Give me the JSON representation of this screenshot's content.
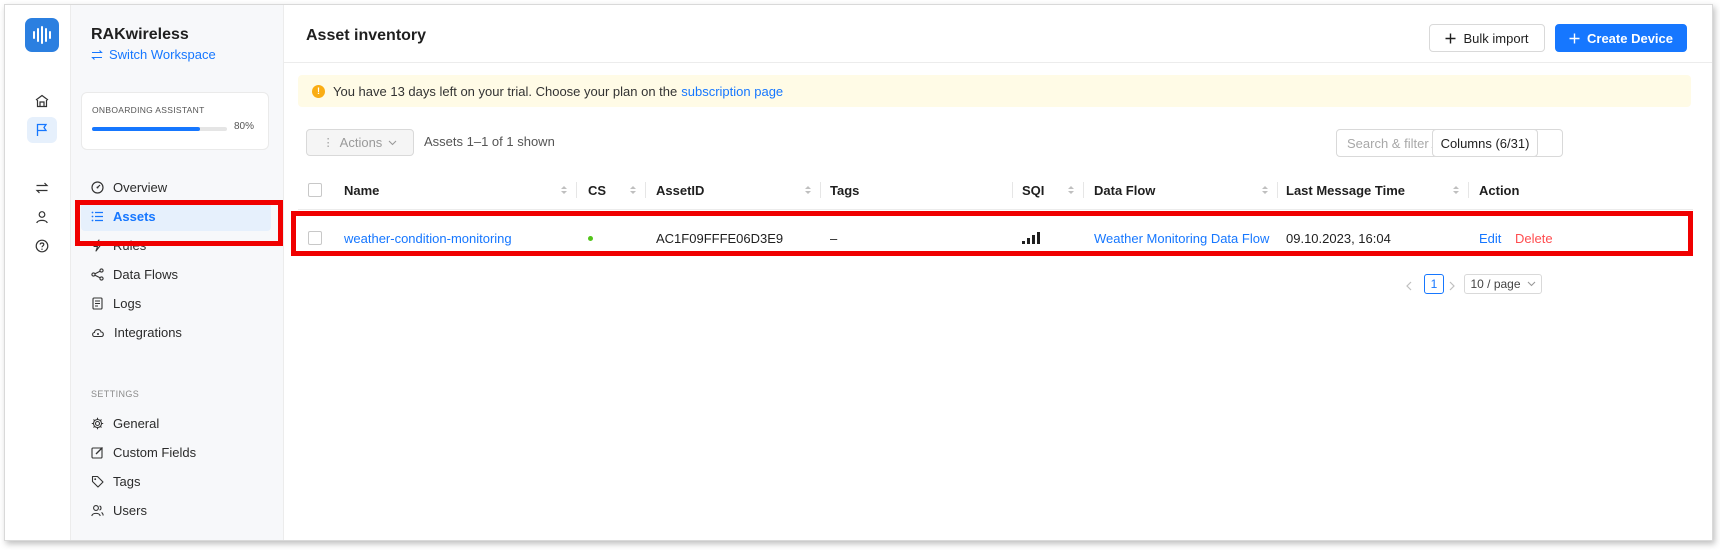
{
  "colors": {
    "accent": "#1677ff",
    "highlight": "#f00000",
    "trial_bg": "#fffbe6",
    "online": "#52c41a",
    "danger": "#ff4d4f"
  },
  "rail": {
    "icons": [
      "home-icon",
      "flag-icon",
      "swap-icon",
      "user-icon",
      "help-icon"
    ]
  },
  "sidebar": {
    "org_name": "RAKwireless",
    "switch_workspace": "Switch Workspace",
    "onboarding": {
      "title": "ONBOARDING ASSISTANT",
      "progress_percent": 80,
      "progress_label": "80%"
    },
    "nav": [
      {
        "label": "Overview",
        "icon": "dashboard-icon"
      },
      {
        "label": "Assets",
        "icon": "list-icon",
        "active": true
      },
      {
        "label": "Rules",
        "icon": "bolt-icon"
      },
      {
        "label": "Data Flows",
        "icon": "share-icon"
      },
      {
        "label": "Logs",
        "icon": "log-icon"
      },
      {
        "label": "Integrations",
        "icon": "cloud-icon"
      }
    ],
    "settings_label": "SETTINGS",
    "settings": [
      {
        "label": "General",
        "icon": "gear-icon"
      },
      {
        "label": "Custom Fields",
        "icon": "edit-icon"
      },
      {
        "label": "Tags",
        "icon": "tag-icon"
      },
      {
        "label": "Users",
        "icon": "users-icon"
      }
    ]
  },
  "header": {
    "title": "Asset inventory",
    "bulk_import": "Bulk import",
    "create_device": "Create Device"
  },
  "trial": {
    "text": "You have 13 days left on your trial. Choose your plan on the",
    "link": "subscription page"
  },
  "toolbar": {
    "actions": "Actions",
    "count": "Assets 1–1 of 1 shown",
    "search_placeholder": "Search & filter Asset list",
    "columns": "Columns (6/31)"
  },
  "table": {
    "headers": {
      "name": "Name",
      "cs": "CS",
      "asset_id": "AssetID",
      "tags": "Tags",
      "sqi": "SQI",
      "data_flow": "Data Flow",
      "last_message": "Last Message Time",
      "action": "Action"
    },
    "rows": [
      {
        "name": "weather-condition-monitoring",
        "cs_status": "online",
        "asset_id": "AC1F09FFFE06D3E9",
        "tags": "–",
        "sqi_bars": 4,
        "data_flow": "Weather Monitoring Data Flow",
        "last_message": "09.10.2023, 16:04",
        "edit": "Edit",
        "delete": "Delete"
      }
    ]
  },
  "pagination": {
    "page": "1",
    "page_size": "10 / page"
  }
}
